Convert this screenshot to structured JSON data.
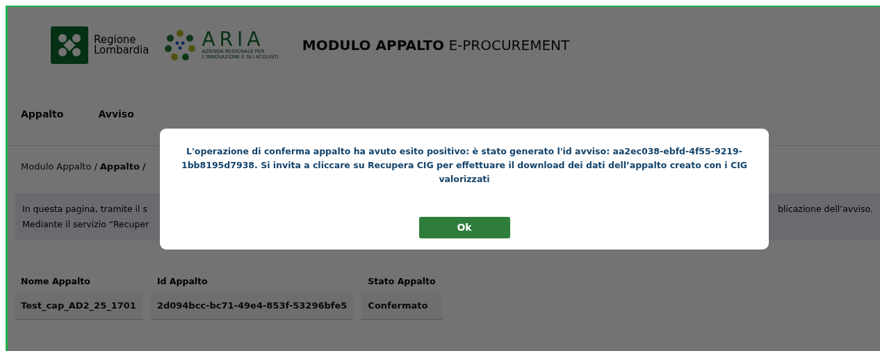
{
  "header": {
    "logos": [
      {
        "kind": "regione",
        "lines": [
          "Regione",
          "Lombardia"
        ]
      },
      {
        "kind": "aria",
        "name": "ARIA",
        "subtitle": [
          "AZIENDA REGIONALE PER",
          "L'INNOVAZIONE E GLI ACQUISTI"
        ]
      }
    ],
    "title_bold": "MODULO APPALTO",
    "title_rest": "E-PROCUREMENT"
  },
  "nav": [
    {
      "label": "Appalto"
    },
    {
      "label": "Avviso"
    }
  ],
  "breadcrumb": {
    "separator": "/",
    "items": [
      {
        "label": "Modulo Appalto",
        "current": false
      },
      {
        "label": "Appalto",
        "current": true
      }
    ]
  },
  "info": {
    "line_1_start": "In questa pagina, tramite il s",
    "line_1_end": "blicazione dell’avviso.",
    "line_2_start": "Mediante il servizio “Recuper"
  },
  "summary": {
    "columns": [
      "Nome Appalto",
      "Id Appalto",
      "Stato Appalto"
    ],
    "values": [
      "Test_cap_AD2_25_1701",
      "2d094bcc-bc71-49e4-853f-53296bfe5",
      "Confermato"
    ]
  },
  "modal": {
    "message": "L'operazione di conferma appalto ha avuto esito positivo: è stato generato l'id avviso: aa2ec038-ebfd-4f55-9219-1bb8195d7938. Si invita a cliccare su Recupera CIG per effettuare il download dei dati dell’appalto creato con i CIG valorizzati",
    "button": "Ok"
  }
}
